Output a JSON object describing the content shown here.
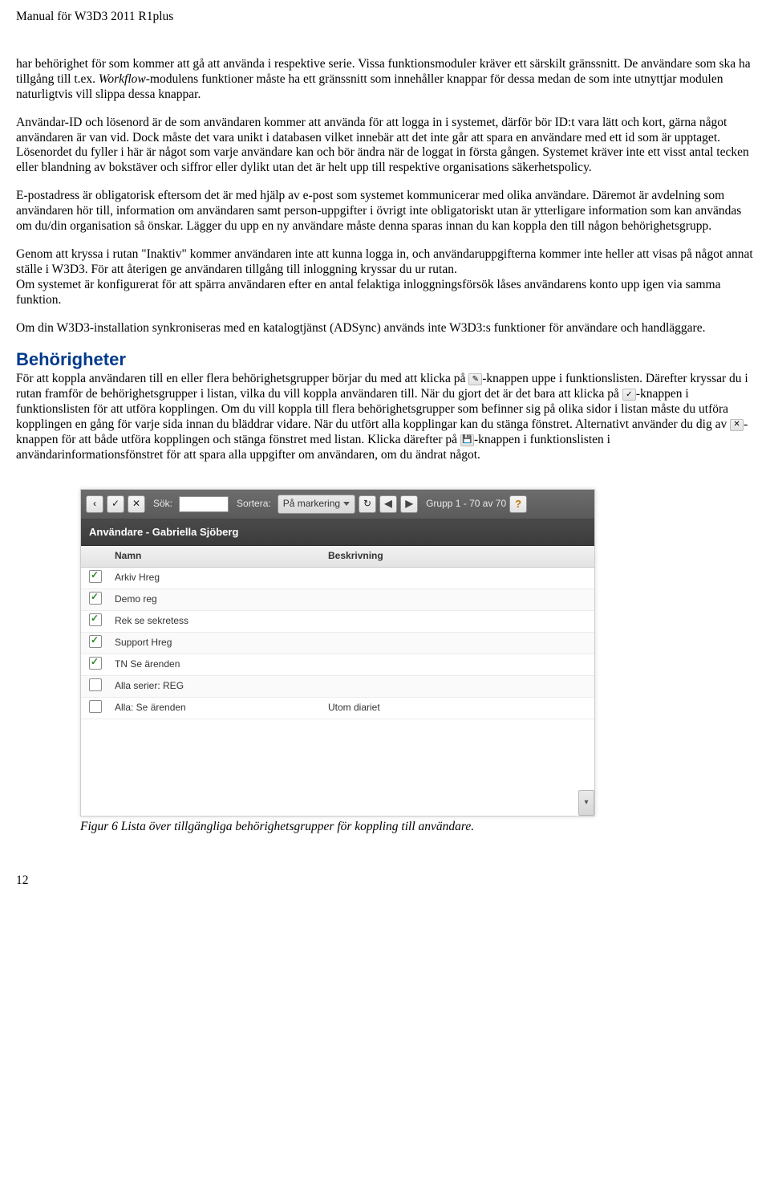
{
  "header": {
    "title": "Manual för W3D3 2011 R1plus"
  },
  "paragraphs": {
    "p1a": "har behörighet för som kommer att gå att använda i respektive serie. Vissa funktionsmoduler kräver ett särskilt gränssnitt. De användare som ska ha tillgång till t.ex. ",
    "p1b": "Workflow",
    "p1c": "-modulens funktioner måste ha ett gränssnitt som innehåller knappar för dessa medan de som inte utnyttjar modulen naturligtvis vill slippa dessa knappar.",
    "p2": "Användar-ID och lösenord är de som användaren kommer att använda för att logga in i systemet, därför bör ID:t vara lätt och kort, gärna något användaren är van vid. Dock måste det vara unikt i databasen vilket innebär att det inte går att spara en användare med ett id som är upptaget. Lösenordet du fyller i här är något som varje användare kan och bör ändra när de loggat in första gången. Systemet kräver inte ett visst antal tecken eller blandning av bokstäver och siffror eller dylikt utan det är helt upp till respektive organisations säkerhetspolicy.",
    "p3": "E-postadress är obligatorisk eftersom det är med hjälp av e-post som systemet kommunicerar med olika användare. Däremot är avdelning som användaren hör till, information om användaren samt person-uppgifter i övrigt inte obligatoriskt utan är ytterligare information som kan användas om du/din organisation så önskar. Lägger du upp en ny användare måste denna sparas innan du kan koppla den till någon behörighetsgrupp.",
    "p4": "Genom att kryssa i rutan \"Inaktiv\" kommer användaren inte att kunna logga in, och användaruppgifterna kommer inte heller att visas på något annat ställe i W3D3. För att återigen ge användaren tillgång till inloggning kryssar du ur rutan.\nOm systemet är konfigurerat för att spärra användaren efter en antal felaktiga inloggningsförsök låses användarens konto upp igen via samma funktion.",
    "p5": "Om din W3D3-installation synkroniseras med en katalogtjänst (ADSync) används inte W3D3:s funktioner för användare och handläggare.",
    "h2": "Behörigheter",
    "p6a": "För att koppla användaren till en eller flera behörighetsgrupper börjar du med att klicka på ",
    "p6b": "-knappen uppe i funktionslisten. Därefter kryssar du i rutan framför de behörighetsgrupper i listan, vilka du vill koppla användaren till. När du gjort det är det bara att klicka på ",
    "p6c": "-knappen i funktionslisten för att utföra kopplingen. Om du vill koppla till flera behörighetsgrupper som befinner sig på olika sidor i listan måste du utföra kopplingen en gång för varje sida innan du bläddrar vidare. När du utfört alla kopplingar kan du stänga fönstret. Alternativt använder du dig av ",
    "p6d": "-knappen för att både utföra kopplingen och stänga fönstret med listan. Klicka därefter på ",
    "p6e": "-knappen i funktionslisten i användarinformationsfönstret för att spara alla uppgifter om användaren, om du ändrat något."
  },
  "figure": {
    "caption": "Figur 6 Lista över tillgängliga behörighetsgrupper för koppling till användare."
  },
  "shot": {
    "toolbar": {
      "search_label": "Sök:",
      "sort_label": "Sortera:",
      "sort_value": "På markering",
      "pager": "Grupp 1 - 70 av 70"
    },
    "titlebar": "Användare - Gabriella Sjöberg",
    "columns": {
      "name": "Namn",
      "desc": "Beskrivning"
    },
    "rows": [
      {
        "checked": true,
        "name": "Arkiv Hreg",
        "desc": ""
      },
      {
        "checked": true,
        "name": "Demo reg",
        "desc": ""
      },
      {
        "checked": true,
        "name": "Rek se sekretess",
        "desc": ""
      },
      {
        "checked": true,
        "name": "Support Hreg",
        "desc": ""
      },
      {
        "checked": true,
        "name": "TN Se ärenden",
        "desc": ""
      },
      {
        "checked": false,
        "name": "Alla serier: REG",
        "desc": ""
      },
      {
        "checked": false,
        "name": "Alla: Se ärenden",
        "desc": "Utom diariet"
      }
    ]
  },
  "pagenum": "12"
}
